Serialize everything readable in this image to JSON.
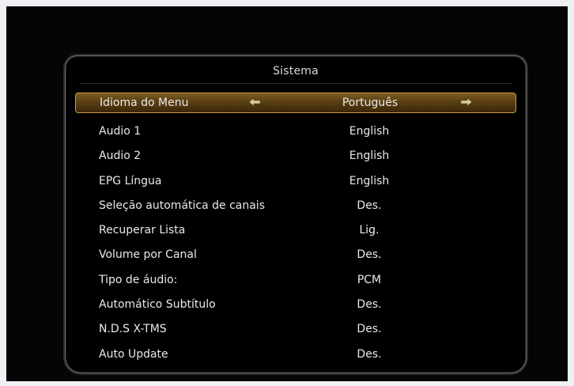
{
  "dialog": {
    "title": "Sistema"
  },
  "menu": {
    "items": [
      {
        "label": "Idioma do Menu",
        "value": "Português"
      },
      {
        "label": "Audio 1",
        "value": "English"
      },
      {
        "label": "Audio 2",
        "value": "English"
      },
      {
        "label": "EPG Língua",
        "value": "English"
      },
      {
        "label": "Seleção automática de canais",
        "value": "Des."
      },
      {
        "label": "Recuperar Lista",
        "value": "Lig."
      },
      {
        "label": "Volume por Canal",
        "value": "Des."
      },
      {
        "label": "Tipo de áudio:",
        "value": "PCM"
      },
      {
        "label": "Automático Subtítulo",
        "value": "Des."
      },
      {
        "label": "N.D.S X-TMS",
        "value": "Des."
      },
      {
        "label": "Auto Update",
        "value": "Des."
      }
    ],
    "selected_index": 0,
    "arrow_icons": [
      "arrow-left-icon",
      "arrow-right-icon"
    ]
  },
  "colors": {
    "screen_bg": "#050505",
    "highlight": "#7a5a1f",
    "highlight_border": "#c99b45",
    "text": "#e9e9e9"
  }
}
